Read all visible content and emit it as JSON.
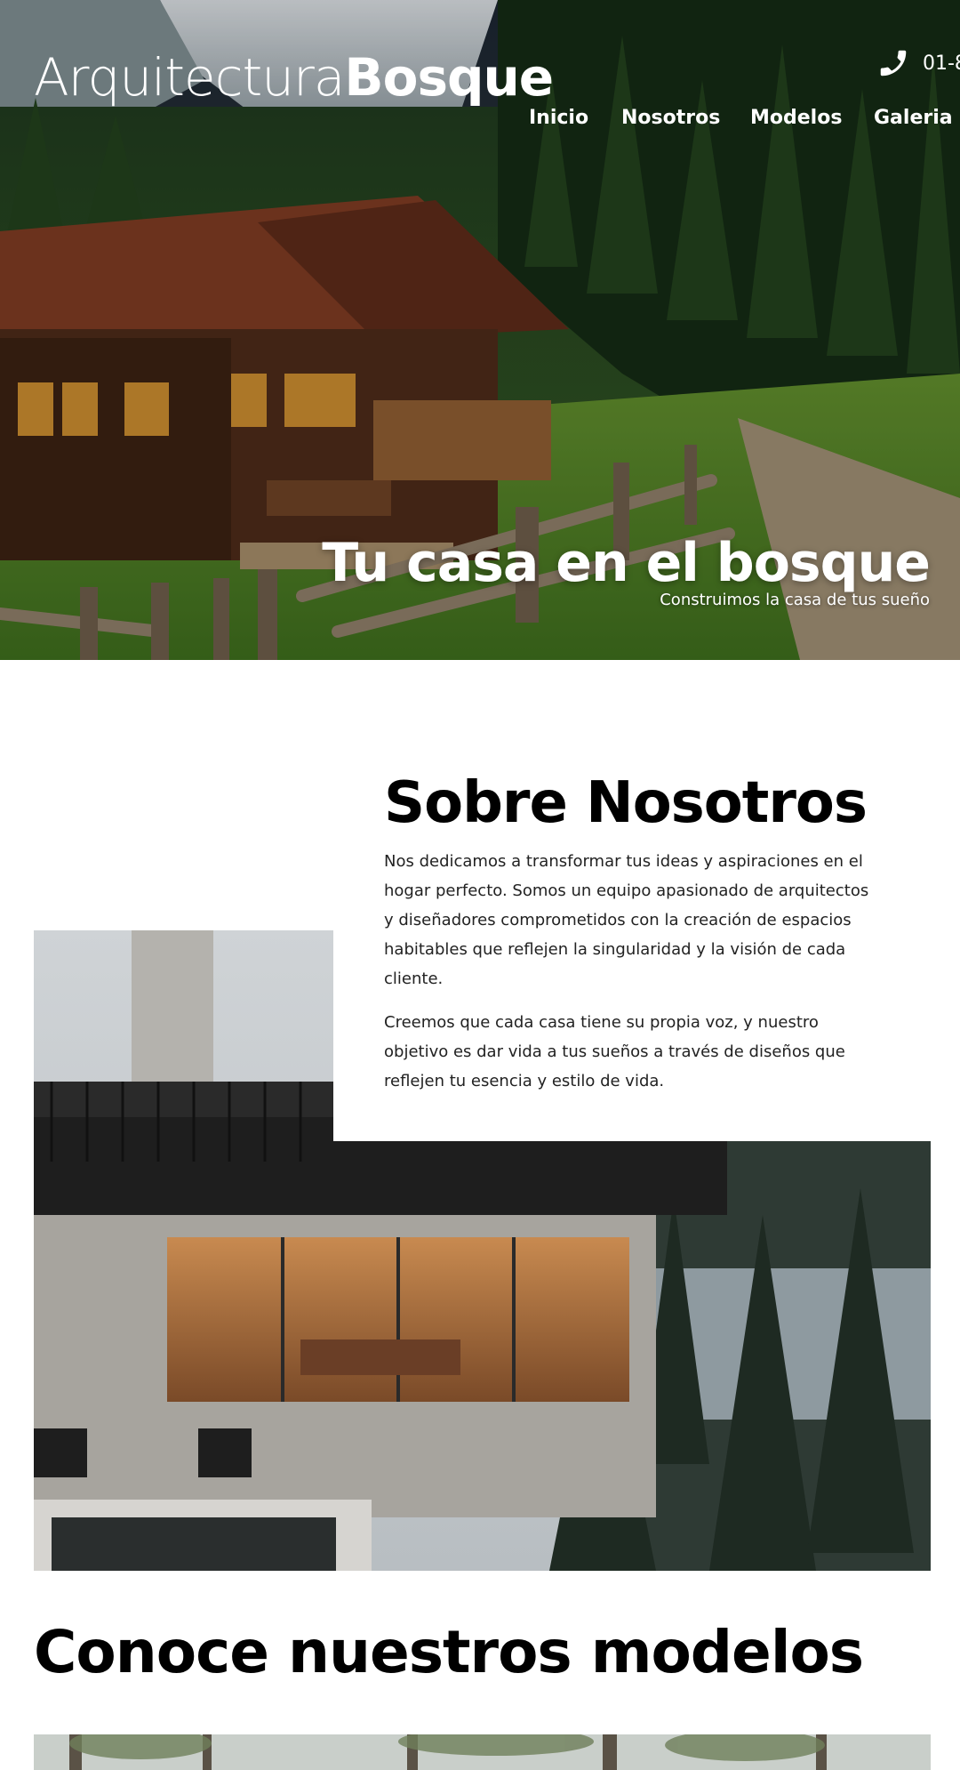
{
  "header": {
    "logo_light": "Arquitectura",
    "logo_bold": "Bosque",
    "phone": "01-8"
  },
  "nav": {
    "items": [
      "Inicio",
      "Nosotros",
      "Modelos",
      "Galeria"
    ]
  },
  "hero": {
    "title": "Tu casa en el bosque",
    "subtitle": "Construimos la casa de tus sueño"
  },
  "about": {
    "title": "Sobre Nosotros",
    "paragraph1": "Nos dedicamos a transformar tus ideas y aspiraciones en el hogar perfecto. Somos un equipo apasionado de arquitectos y diseñadores comprometidos con la creación de espacios habitables que reflejen la singularidad y la visión de cada cliente.",
    "paragraph2": "Creemos que cada casa tiene su propia voz, y nuestro objetivo es dar vida a tus sueños a través de diseños que reflejen tu esencia y estilo de vida."
  },
  "models": {
    "title": "Conoce nuestros modelos"
  },
  "icons": {
    "phone": "phone-icon"
  },
  "colors": {
    "text_dark": "#000000",
    "hero_text": "#ffffff",
    "background": "#ffffff"
  }
}
